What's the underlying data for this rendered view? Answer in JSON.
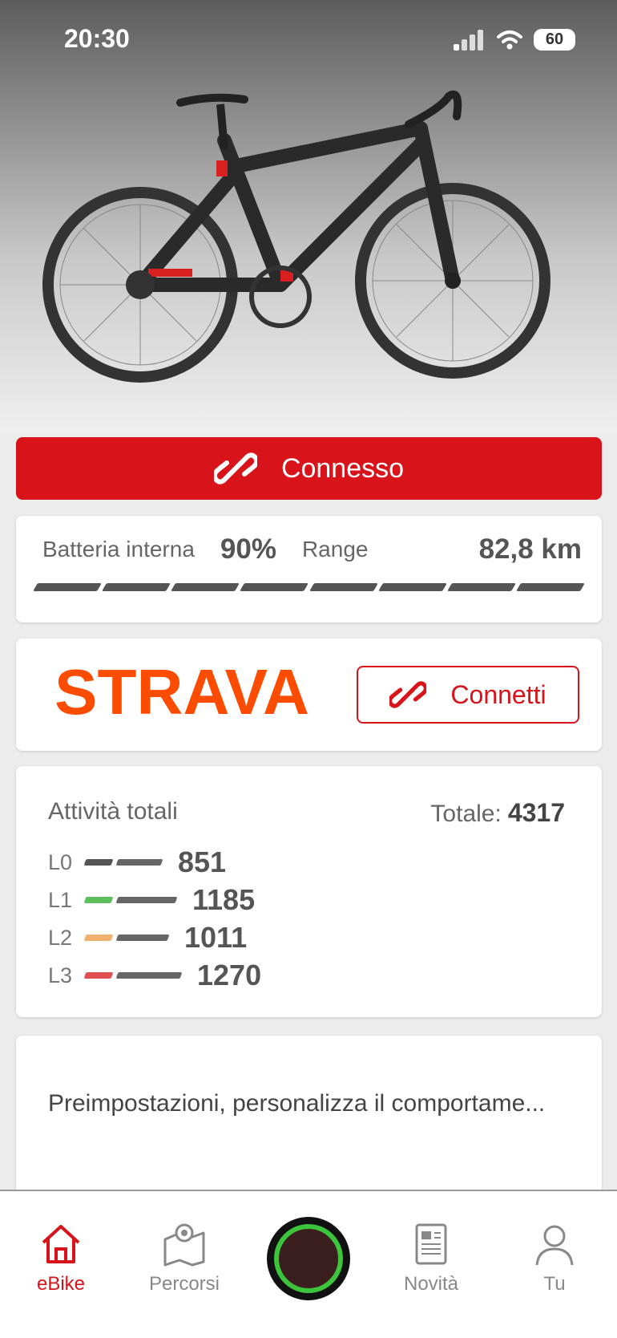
{
  "status_bar": {
    "time": "20:30",
    "battery": "60"
  },
  "connection": {
    "label": "Connesso"
  },
  "battery": {
    "label": "Batteria interna",
    "value": "90%",
    "range_label": "Range",
    "range_value": "82,8 km",
    "segments_filled": 8
  },
  "strava": {
    "logo_text": "STRAVA",
    "connect_label": "Connetti"
  },
  "activity": {
    "title": "Attività totali",
    "total_label": "Totale:",
    "total_value": "4317",
    "levels": [
      {
        "name": "L0",
        "value": "851",
        "color": "#555555"
      },
      {
        "name": "L1",
        "value": "1185",
        "color": "#5cbf5c"
      },
      {
        "name": "L2",
        "value": "1011",
        "color": "#f0b070"
      },
      {
        "name": "L3",
        "value": "1270",
        "color": "#e05050"
      }
    ]
  },
  "presets": {
    "text": "Preimpostazioni, personalizza il comportame..."
  },
  "nav": {
    "items": [
      {
        "label": "eBike",
        "icon": "home-icon"
      },
      {
        "label": "Percorsi",
        "icon": "map-icon"
      },
      {
        "label": "Novità",
        "icon": "news-icon"
      },
      {
        "label": "Tu",
        "icon": "user-icon"
      }
    ]
  },
  "colors": {
    "brand_red": "#d81319",
    "strava_orange": "#fc4c02",
    "ring_green": "#3cc53c"
  }
}
